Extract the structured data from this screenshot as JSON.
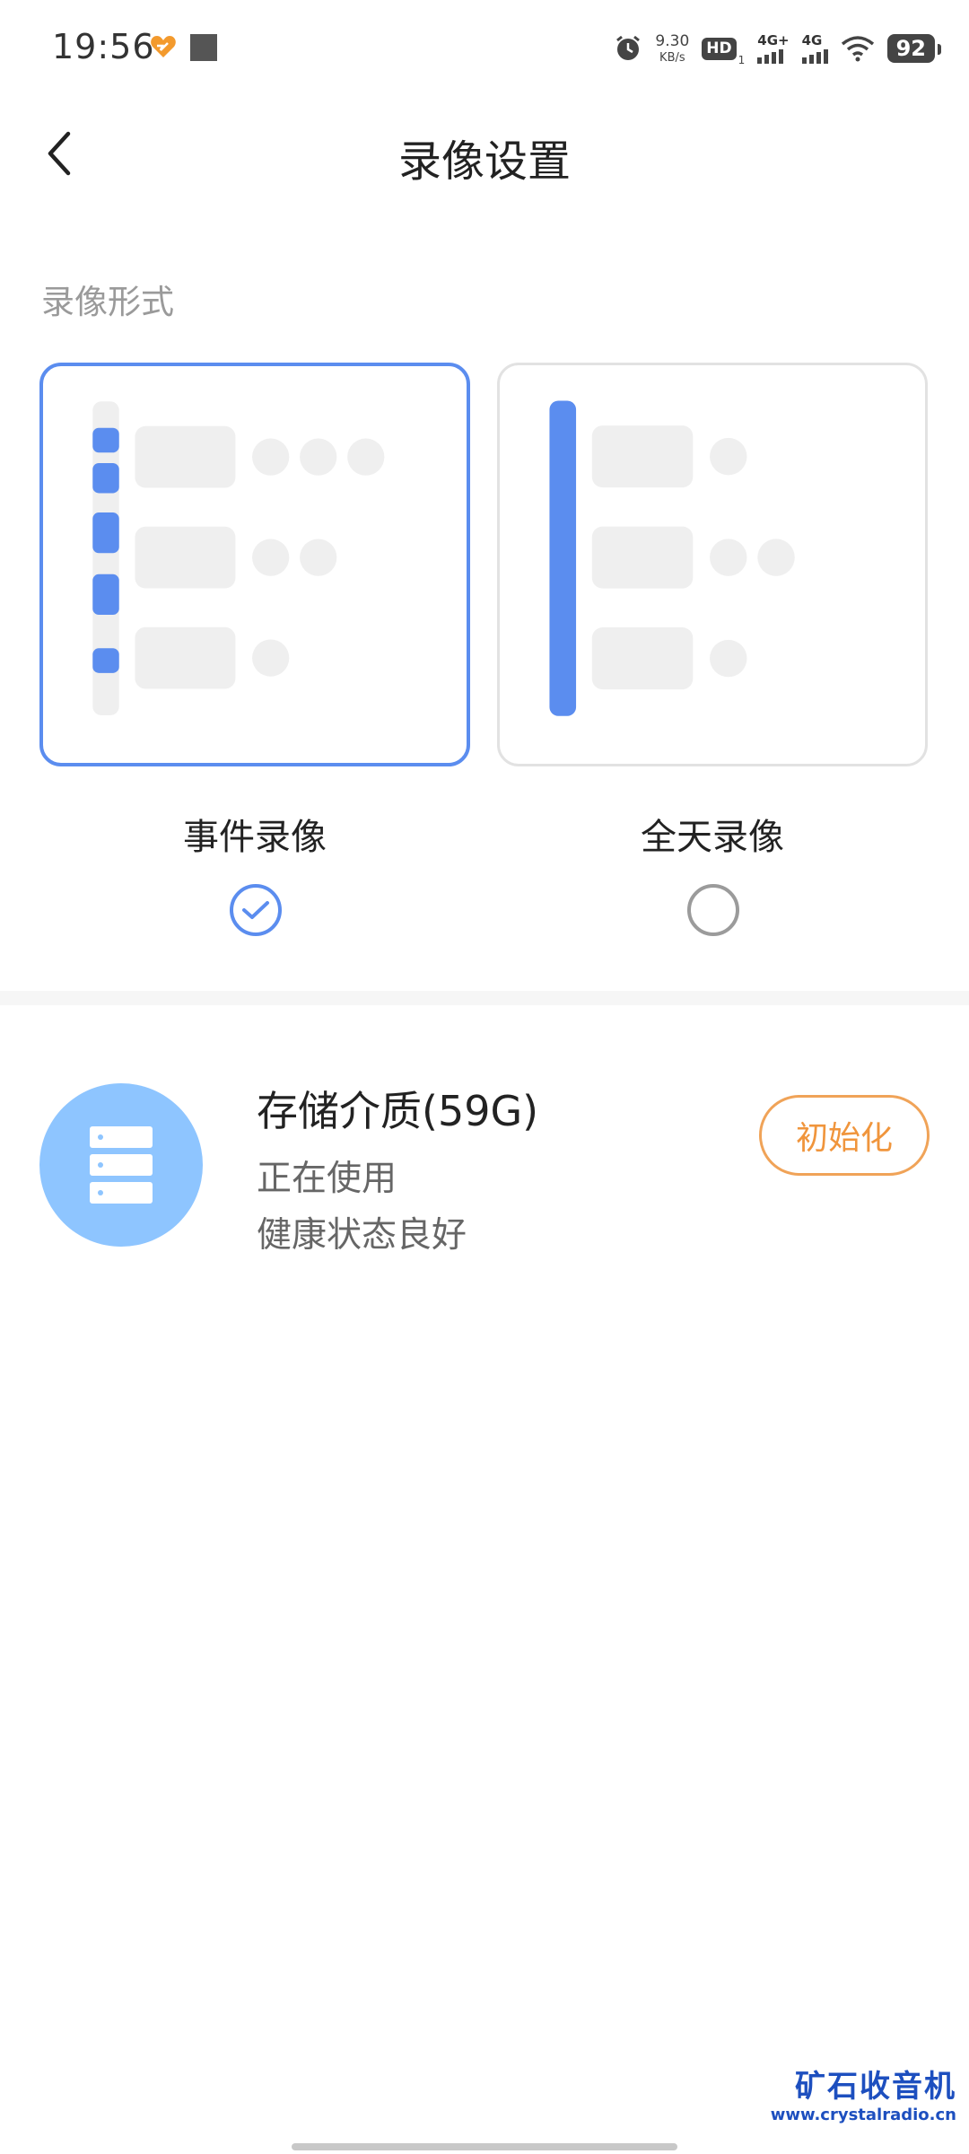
{
  "status_bar": {
    "time": "19:56",
    "net_speed_value": "9.30",
    "net_speed_unit": "KB/s",
    "hd_label": "HD",
    "hd_sub": "1",
    "sim1_label": "4G+",
    "sim2_label": "4G",
    "battery": "92",
    "icons": [
      "heart-icon",
      "notification-square-icon",
      "alarm-icon",
      "wifi-icon"
    ]
  },
  "header": {
    "title": "录像设置",
    "back_icon": "chevron-left-icon"
  },
  "recording_mode": {
    "section_label": "录像形式",
    "options": [
      {
        "label": "事件录像",
        "selected": true
      },
      {
        "label": "全天录像",
        "selected": false
      }
    ],
    "accent_color": "#5b8def"
  },
  "storage": {
    "icon": "storage-server-icon",
    "title": "存储介质(59G)",
    "status": "正在使用",
    "health": "健康状态良好",
    "init_button_label": "初始化",
    "button_color": "#f0953c"
  },
  "watermark": {
    "brand": "矿石收音机",
    "url": "www.crystalradio.cn"
  }
}
